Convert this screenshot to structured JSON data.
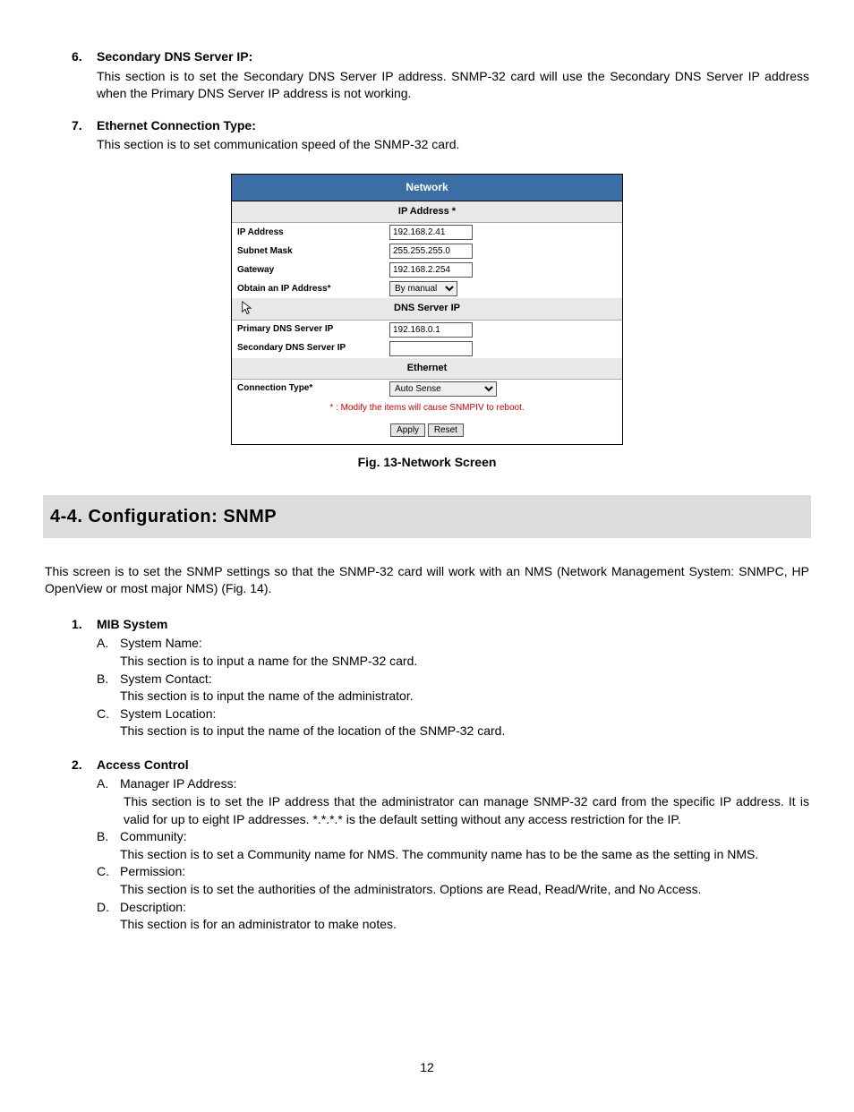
{
  "item6": {
    "num": "6.",
    "title": "Secondary DNS Server IP:",
    "body": "This section is to set the Secondary DNS Server IP address.  SNMP-32 card will use the Secondary DNS Server IP address when the Primary DNS Server IP address is not working."
  },
  "item7": {
    "num": "7.",
    "title": "Ethernet Connection Type:",
    "body": "This section is to set communication speed of the SNMP-32 card."
  },
  "figure": {
    "header": "Network",
    "sub_ip": "IP Address *",
    "rows": {
      "ip_label": "IP Address",
      "ip_value": "192.168.2.41",
      "mask_label": "Subnet Mask",
      "mask_value": "255.255.255.0",
      "gw_label": "Gateway",
      "gw_value": "192.168.2.254",
      "obtain_label": "Obtain an IP Address*",
      "obtain_value": "By manual"
    },
    "sub_dns": "DNS Server IP",
    "dns": {
      "primary_label": "Primary DNS Server IP",
      "primary_value": "192.168.0.1",
      "secondary_label": "Secondary DNS Server IP",
      "secondary_value": ""
    },
    "sub_eth": "Ethernet",
    "eth": {
      "conn_label": "Connection Type*",
      "conn_value": "Auto Sense"
    },
    "note": "* : Modify the items will cause SNMPIV to reboot.",
    "apply": "Apply",
    "reset": "Reset",
    "caption": "Fig. 13-Network Screen"
  },
  "section44": {
    "title": "4-4.  Configuration: SNMP",
    "intro": "This screen is to set the SNMP settings so that the SNMP-32 card will work with an NMS (Network Management System: SNMPC, HP OpenView or most major NMS) (Fig. 14)."
  },
  "mib": {
    "num": "1.",
    "title": "MIB System",
    "a_l": "A.",
    "a_t": "System Name:",
    "a_b": "This section is to input a name for the SNMP-32 card.",
    "b_l": "B.",
    "b_t": "System Contact:",
    "b_b": "This section is to input the name of the administrator.",
    "c_l": "C.",
    "c_t": "System Location:",
    "c_b": "This section is to input the name of the location of the SNMP-32 card."
  },
  "ac": {
    "num": "2.",
    "title": "Access Control",
    "a_l": "A.",
    "a_t": "Manager IP Address:",
    "a_b": "This section is to set the IP address that the administrator can manage SNMP-32 card from the specific IP address.  It is valid for up to eight IP addresses.  *.*.*.* is the default setting without any access restriction for the IP.",
    "b_l": "B.",
    "b_t": "Community:",
    "b_b": "This section is to set a Community name for NMS.  The community name has to be the same as the setting in NMS.",
    "c_l": "C.",
    "c_t": "Permission:",
    "c_b": "This section is to set the authorities of the administrators.  Options are Read, Read/Write, and No Access.",
    "d_l": "D.",
    "d_t": "Description:",
    "d_b": "This section is for an administrator to make notes."
  },
  "page": "12"
}
